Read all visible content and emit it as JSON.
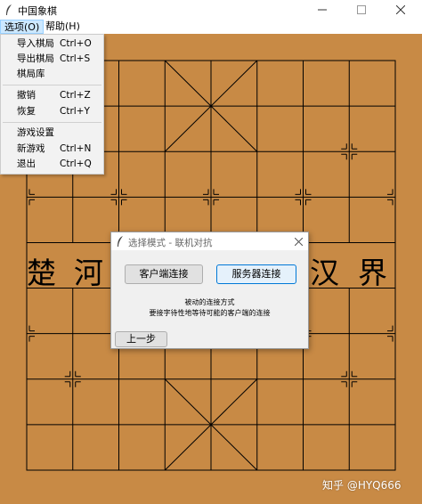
{
  "window": {
    "title": "中国象棋",
    "minimize_icon": "minimize-icon",
    "maximize_icon": "maximize-icon",
    "close_icon": "close-icon"
  },
  "menubar": {
    "options_label": "选项(O)",
    "help_label": "帮助(H)"
  },
  "options_menu": {
    "items": [
      {
        "label": "导入棋局",
        "accel": "Ctrl+O"
      },
      {
        "label": "导出棋局",
        "accel": "Ctrl+S"
      },
      {
        "label": "棋局库",
        "accel": ""
      },
      {
        "label": "撤销",
        "accel": "Ctrl+Z"
      },
      {
        "label": "恢复",
        "accel": "Ctrl+Y"
      },
      {
        "label": "游戏设置",
        "accel": ""
      },
      {
        "label": "新游戏",
        "accel": "Ctrl+N"
      },
      {
        "label": "退出",
        "accel": "Ctrl+Q"
      }
    ]
  },
  "board": {
    "river_left": [
      "楚",
      "河"
    ],
    "river_right": [
      "汉",
      "界"
    ],
    "background_color": "#c88a45"
  },
  "dialog": {
    "title": "选择模式 - 联机对抗",
    "client_button": "客户端连接",
    "server_button": "服务器连接",
    "desc_line1": "被动的连接方式",
    "desc_line2": "要接字待性地等待可能的客户端的连接",
    "back_button": "上一步"
  },
  "watermark": "知乎 @HYQ666"
}
